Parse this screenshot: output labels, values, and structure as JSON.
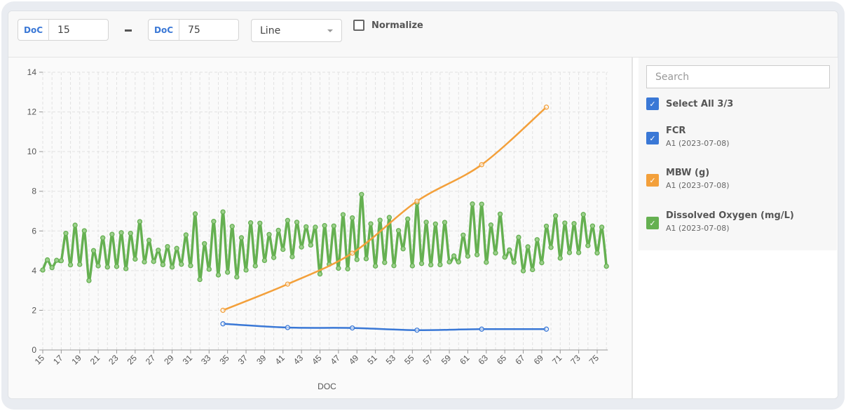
{
  "toolbar": {
    "from": {
      "prefix": "DoC",
      "value": "15"
    },
    "separator": "–",
    "to": {
      "prefix": "DoC",
      "value": "75"
    },
    "chart_type": "Line",
    "normalize": {
      "label": "Normalize",
      "checked": false
    }
  },
  "legend": {
    "search_placeholder": "Search",
    "select_all_label": "Select All 3/3",
    "items": [
      {
        "title": "FCR",
        "subtitle": "A1 (2023-07-08)",
        "color": "#3a78d6",
        "checked": true
      },
      {
        "title": "MBW (g)",
        "subtitle": "A1 (2023-07-08)",
        "color": "#f3a03b",
        "checked": true
      },
      {
        "title": "Dissolved Oxygen (mg/L)",
        "subtitle": "A1 (2023-07-08)",
        "color": "#65b051",
        "checked": true
      }
    ]
  },
  "chart_data": {
    "type": "line",
    "title": "",
    "xlabel": "DOC",
    "ylabel": "",
    "xlim": [
      15,
      76
    ],
    "ylim": [
      0,
      14
    ],
    "yticks": [
      0,
      2,
      4,
      6,
      8,
      10,
      12,
      14
    ],
    "xticks": [
      15,
      17,
      19,
      21,
      23,
      25,
      27,
      29,
      31,
      33,
      35,
      37,
      39,
      41,
      43,
      45,
      47,
      49,
      51,
      53,
      55,
      57,
      59,
      61,
      63,
      65,
      67,
      69,
      71,
      73,
      75
    ],
    "grid": true,
    "legend_position": "right",
    "series": [
      {
        "name": "FCR",
        "color": "#3a78d6",
        "x": [
          34.5,
          41.5,
          48.5,
          55.5,
          62.5,
          69.5
        ],
        "y": [
          1.32,
          1.13,
          1.11,
          1.0,
          1.05,
          1.05
        ]
      },
      {
        "name": "MBW (g)",
        "color": "#f3a03b",
        "x": [
          34.5,
          41.5,
          48.5,
          55.5,
          62.5,
          69.5
        ],
        "y": [
          2.0,
          3.32,
          4.88,
          7.5,
          9.34,
          12.24
        ]
      },
      {
        "name": "Dissolved Oxygen (mg/L)",
        "color": "#65b051",
        "x": [
          15,
          15.5,
          16,
          16.5,
          17,
          17.5,
          18,
          18.5,
          19,
          19.5,
          20,
          20.5,
          21,
          21.5,
          22,
          22.5,
          23,
          23.5,
          24,
          24.5,
          25,
          25.5,
          26,
          26.5,
          27,
          27.5,
          28,
          28.5,
          29,
          29.5,
          30,
          30.5,
          31,
          31.5,
          32,
          32.5,
          33,
          33.5,
          34,
          34.5,
          35,
          35.5,
          36,
          36.5,
          37,
          37.5,
          38,
          38.5,
          39,
          39.5,
          40,
          40.5,
          41,
          41.5,
          42,
          42.5,
          43,
          43.5,
          44,
          44.5,
          45,
          45.5,
          46,
          46.5,
          47,
          47.5,
          48,
          48.5,
          49,
          49.5,
          50,
          50.5,
          51,
          51.5,
          52,
          52.5,
          53,
          53.5,
          54,
          54.5,
          55,
          55.5,
          56,
          56.5,
          57,
          57.5,
          58,
          58.5,
          59,
          59.5,
          60,
          60.5,
          61,
          61.5,
          62,
          62.5,
          63,
          63.5,
          64,
          64.5,
          65,
          65.5,
          66,
          66.5,
          67,
          67.5,
          68,
          68.5,
          69,
          69.5,
          70,
          70.5,
          71,
          71.5,
          72,
          72.5,
          73,
          73.5,
          74,
          74.5,
          75,
          75.5,
          76
        ],
        "y": [
          4.03,
          4.54,
          4.15,
          4.52,
          4.5,
          5.88,
          4.29,
          6.29,
          4.31,
          6.01,
          3.5,
          5.01,
          4.24,
          5.65,
          4.18,
          5.83,
          4.21,
          5.91,
          4.1,
          5.88,
          4.58,
          6.47,
          4.44,
          5.53,
          4.46,
          5.03,
          4.3,
          5.21,
          4.18,
          5.12,
          4.32,
          5.8,
          4.25,
          6.86,
          3.55,
          5.36,
          4.07,
          6.48,
          3.78,
          6.96,
          3.92,
          6.23,
          3.68,
          5.66,
          4.03,
          6.41,
          4.24,
          6.39,
          4.51,
          5.82,
          4.66,
          6.03,
          5.07,
          6.53,
          4.7,
          6.44,
          5.19,
          6.21,
          5.29,
          6.19,
          3.83,
          6.27,
          4.32,
          6.25,
          4.12,
          6.82,
          4.09,
          6.66,
          4.56,
          7.84,
          4.6,
          6.36,
          4.23,
          6.54,
          4.41,
          6.68,
          4.25,
          6.02,
          5.1,
          6.6,
          4.24,
          7.41,
          4.36,
          6.44,
          4.29,
          6.35,
          4.3,
          6.43,
          4.44,
          4.74,
          4.44,
          5.79,
          4.73,
          7.36,
          4.8,
          7.35,
          4.42,
          6.3,
          4.89,
          6.85,
          4.68,
          5.04,
          4.42,
          5.68,
          3.99,
          5.2,
          4.05,
          5.56,
          4.4,
          6.24,
          5.17,
          6.76,
          4.63,
          6.4,
          4.91,
          6.37,
          4.91,
          6.83,
          5.26,
          6.25,
          4.89,
          6.19,
          4.22
        ]
      }
    ]
  }
}
